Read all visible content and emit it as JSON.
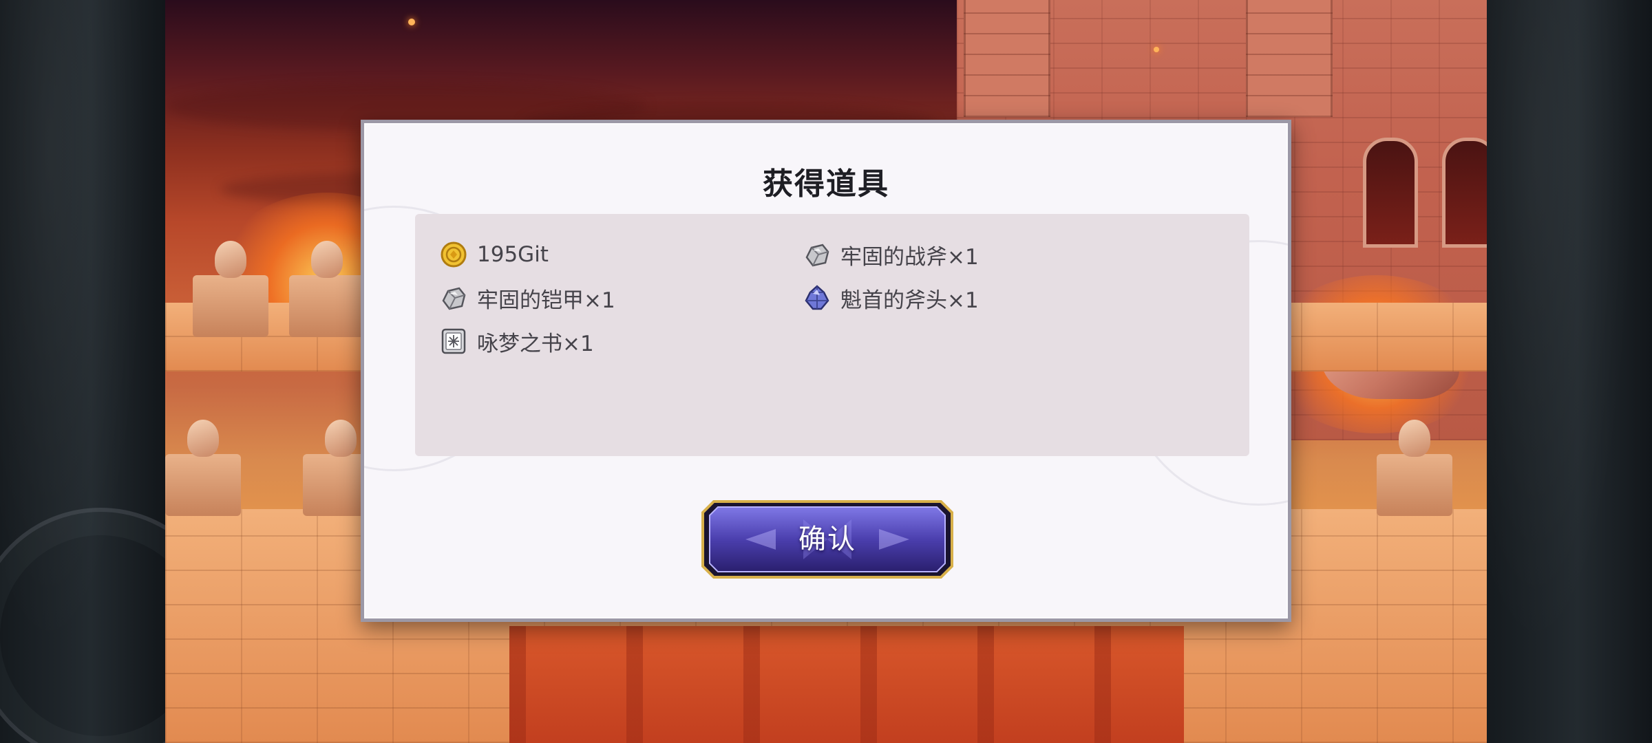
{
  "dialog": {
    "title": "获得道具",
    "items": [
      {
        "label": "195Git",
        "icon": "gold-coin-icon"
      },
      {
        "label": "牢固的战斧×1",
        "icon": "steel-ore-icon"
      },
      {
        "label": "牢固的铠甲×1",
        "icon": "steel-ore-icon"
      },
      {
        "label": "魁首的斧头×1",
        "icon": "blue-crystal-icon"
      },
      {
        "label": "咏梦之书×1",
        "icon": "book-icon"
      }
    ],
    "confirm_label": "确认"
  },
  "colors": {
    "panel": "#f8f6fa",
    "item_box": "#e6dee3",
    "confirm_button": "#5a4fc4",
    "confirm_border": "#d8b04a"
  }
}
